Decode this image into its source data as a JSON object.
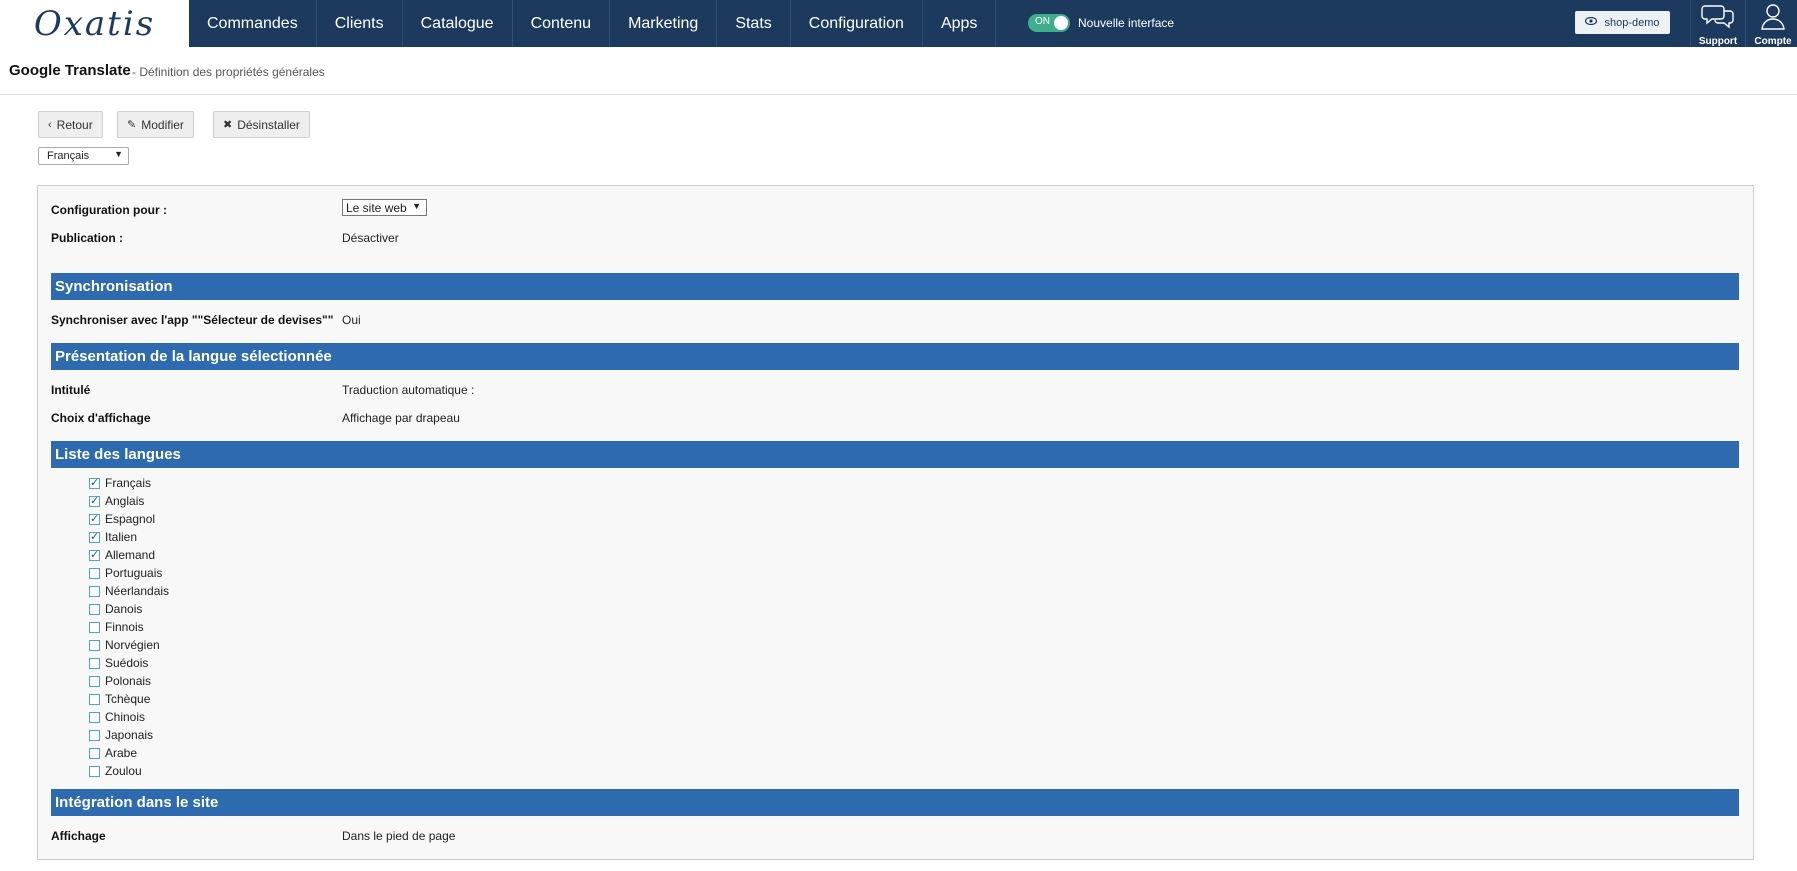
{
  "brand": {
    "logo": "Oxatis"
  },
  "nav": {
    "items": [
      "Commandes",
      "Clients",
      "Catalogue",
      "Contenu",
      "Marketing",
      "Stats",
      "Configuration",
      "Apps"
    ]
  },
  "toggle": {
    "state": "ON",
    "label": "Nouvelle interface",
    "color": "#3fae8c"
  },
  "shop": {
    "label": "shop-demo",
    "icon": "eye-icon"
  },
  "support": {
    "label": "Support",
    "icon": "chat-bubbles-icon"
  },
  "account": {
    "label": "Compte",
    "icon": "user-icon"
  },
  "header": {
    "title": "Google Translate",
    "subtitle": "- Définition des propriétés générales"
  },
  "actions": {
    "back": "Retour",
    "edit": "Modifier",
    "uninstall": "Désinstaller"
  },
  "language_select": {
    "value": "Français"
  },
  "config": {
    "config_for_label": "Configuration pour :",
    "config_for_value": "Le site web",
    "publication_label": "Publication :",
    "publication_value": "Désactiver"
  },
  "sections": {
    "sync": {
      "title": "Synchronisation",
      "label": "Synchroniser avec l'app \"\"Sélecteur de devises\"\"",
      "value": "Oui"
    },
    "presentation": {
      "title": "Présentation de la langue sélectionnée",
      "intitule_label": "Intitulé",
      "intitule_value": "Traduction automatique :",
      "display_label": "Choix d'affichage",
      "display_value": "Affichage par drapeau"
    },
    "languages": {
      "title": "Liste des langues",
      "items": [
        {
          "label": "Français",
          "checked": true
        },
        {
          "label": "Anglais",
          "checked": true
        },
        {
          "label": "Espagnol",
          "checked": true
        },
        {
          "label": "Italien",
          "checked": true
        },
        {
          "label": "Allemand",
          "checked": true
        },
        {
          "label": "Portuguais",
          "checked": false
        },
        {
          "label": "Néerlandais",
          "checked": false
        },
        {
          "label": "Danois",
          "checked": false
        },
        {
          "label": "Finnois",
          "checked": false
        },
        {
          "label": "Norvégien",
          "checked": false
        },
        {
          "label": "Suédois",
          "checked": false
        },
        {
          "label": "Polonais",
          "checked": false
        },
        {
          "label": "Tchèque",
          "checked": false
        },
        {
          "label": "Chinois",
          "checked": false
        },
        {
          "label": "Japonais",
          "checked": false
        },
        {
          "label": "Arabe",
          "checked": false
        },
        {
          "label": "Zoulou",
          "checked": false
        }
      ]
    },
    "integration": {
      "title": "Intégration dans le site",
      "display_label": "Affichage",
      "display_value": "Dans le pied de page"
    }
  },
  "colors": {
    "topbar": "#1c3a5e",
    "section": "#2d6ab0"
  }
}
